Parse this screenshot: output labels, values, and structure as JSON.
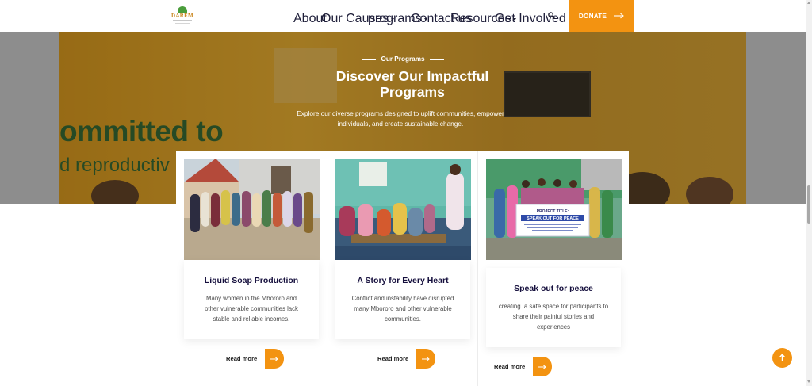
{
  "header": {
    "logo_text": "DAREM",
    "nav": [
      {
        "label": "About",
        "dropdown": false
      },
      {
        "label": "Our Causes",
        "dropdown": true
      },
      {
        "label": "programs",
        "dropdown": true
      },
      {
        "label": "Contact us",
        "dropdown": false
      },
      {
        "label": "Resources",
        "dropdown": true
      },
      {
        "label": "Get Involved",
        "dropdown": true
      }
    ],
    "search_icon": "search-icon",
    "donate_label": "DONATE"
  },
  "hero": {
    "kicker": "Our Programs",
    "title_line1": "Discover Our Impactful",
    "title_line2": "Programs",
    "subtitle_line1": "Explore our diverse programs designed to uplift communities, empower",
    "subtitle_line2": "individuals, and create sustainable change.",
    "background_sign_line1": "ommitted to",
    "background_sign_line2": "d  reproductiv"
  },
  "cards": [
    {
      "title": "Liquid Soap Production",
      "desc_lines": [
        "Many women in the Mbororo and",
        "other vulnerable communities lack",
        "stable and reliable incomes."
      ],
      "read_more": "Read more"
    },
    {
      "title": "A Story for Every Heart",
      "desc_lines": [
        "Conflict and instability have disrupted",
        "many Mbororo and other vulnerable",
        "communities."
      ],
      "read_more": "Read more"
    },
    {
      "title": "Speak out for peace",
      "desc_lines": [
        "creating. a safe space for participants to",
        "share their painful stories and",
        "experiences"
      ],
      "read_more": "Read more",
      "banner_title": "PROJECT TITLE:",
      "banner_main": "SPEAK OUT FOR PEACE"
    }
  ],
  "colors": {
    "accent": "#f39311",
    "title": "#150f3d",
    "sign_green": "#1b5a2e"
  },
  "back_to_top_icon": "arrow-up-icon"
}
